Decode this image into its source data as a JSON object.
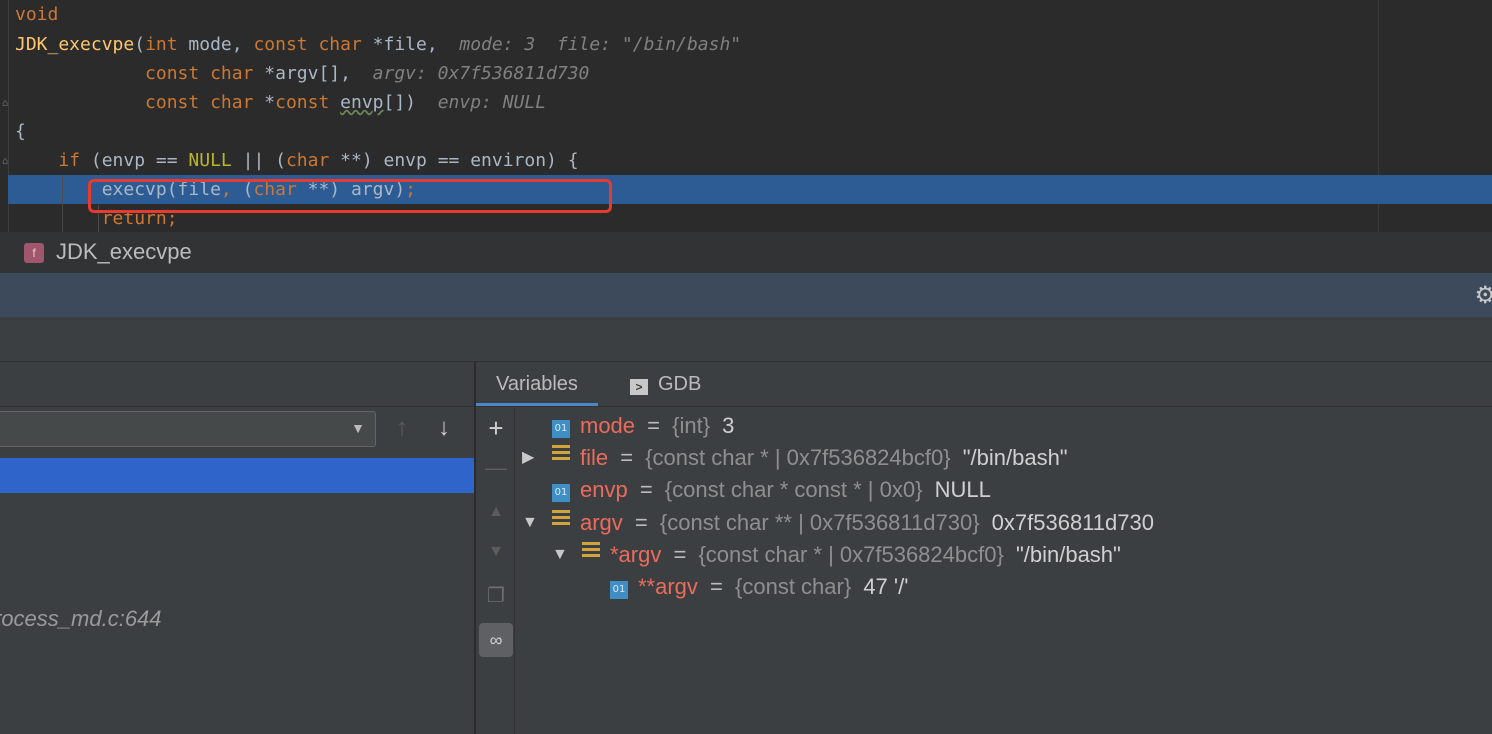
{
  "editor": {
    "lines": [
      {
        "parts": [
          [
            "kw",
            "void"
          ]
        ]
      },
      {
        "parts": [
          [
            "fn",
            "JDK_execvpe"
          ],
          [
            "",
            "("
          ],
          [
            "kw",
            "int "
          ],
          [
            "",
            "mode, "
          ],
          [
            "kw",
            "const char "
          ],
          [
            "",
            "*file,  "
          ],
          [
            "hint",
            "mode: 3  file: \"/bin/bash\""
          ]
        ]
      },
      {
        "parts": [
          [
            "",
            "            "
          ],
          [
            "kw",
            "const char "
          ],
          [
            "",
            "*argv[],  "
          ],
          [
            "hint",
            "argv: 0x7f536811d730"
          ]
        ]
      },
      {
        "parts": [
          [
            "",
            "            "
          ],
          [
            "kw",
            "const char "
          ],
          [
            "",
            "*"
          ],
          [
            "kw",
            "const "
          ],
          [
            "squig",
            "envp"
          ],
          [
            "",
            "[])  "
          ],
          [
            "hint",
            "envp: NULL"
          ]
        ]
      },
      {
        "parts": [
          [
            "",
            "{"
          ]
        ]
      },
      {
        "parts": [
          [
            "",
            "    "
          ],
          [
            "kw",
            "if "
          ],
          [
            "",
            "(envp == "
          ],
          [
            "mac",
            "NULL"
          ],
          [
            "",
            " || ("
          ],
          [
            "kw",
            "char "
          ],
          [
            "",
            "**) envp == environ) {"
          ]
        ]
      },
      {
        "parts": [
          [
            "",
            "        execvp(file"
          ],
          [
            "kw",
            ", "
          ],
          [
            "",
            "("
          ],
          [
            "kw",
            "char "
          ],
          [
            "",
            "**) argv)"
          ],
          [
            "kw",
            ";"
          ]
        ]
      },
      {
        "parts": [
          [
            "",
            "        "
          ],
          [
            "kw",
            "return;"
          ]
        ]
      }
    ]
  },
  "breadcrumb": {
    "icon_letter": "f",
    "function": "JDK_execvpe"
  },
  "frames": {
    "process_frame": "rocess_md.c:644"
  },
  "tabs": {
    "variables": "Variables",
    "gdb": "GDB"
  },
  "variables": [
    {
      "icon": "01",
      "name": "mode",
      "eq": "=",
      "type": "{int}",
      "value": "3",
      "expand": ""
    },
    {
      "icon": "arr",
      "name": "file",
      "eq": "=",
      "type": "{const char * | 0x7f536824bcf0}",
      "value": "\"/bin/bash\"",
      "expand": "▶"
    },
    {
      "icon": "01",
      "name": "envp",
      "eq": "=",
      "type": "{const char * const * | 0x0}",
      "value": "NULL",
      "expand": ""
    },
    {
      "icon": "arr",
      "name": "argv",
      "eq": "=",
      "type": "{const char ** | 0x7f536811d730}",
      "value": "0x7f536811d730",
      "expand": "▼"
    },
    {
      "icon": "arr",
      "name": "*argv",
      "eq": "=",
      "type": "{const char * | 0x7f536824bcf0}",
      "value": "\"/bin/bash\"",
      "expand": "▼"
    },
    {
      "icon": "01",
      "name": "**argv",
      "eq": "=",
      "type": "{const char}",
      "value": "47 '/'",
      "expand": ""
    }
  ],
  "colors": {
    "highlight": "#2d5b93",
    "selection": "#2f65ca",
    "annotation": "#e63b2e"
  }
}
